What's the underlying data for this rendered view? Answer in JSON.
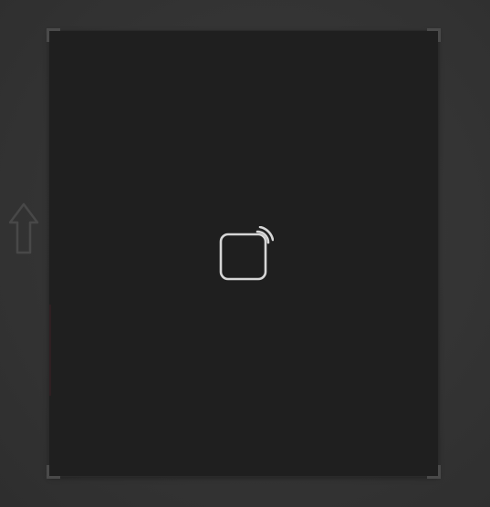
{
  "icons": {
    "side_arrow": "up-arrow-icon",
    "center": "screen-cast-icon"
  },
  "colors": {
    "background": "#353535",
    "canvas": "#1f1f1f",
    "icon_stroke": "#d6d6d6",
    "corner_marks": "#4a4a4a"
  }
}
